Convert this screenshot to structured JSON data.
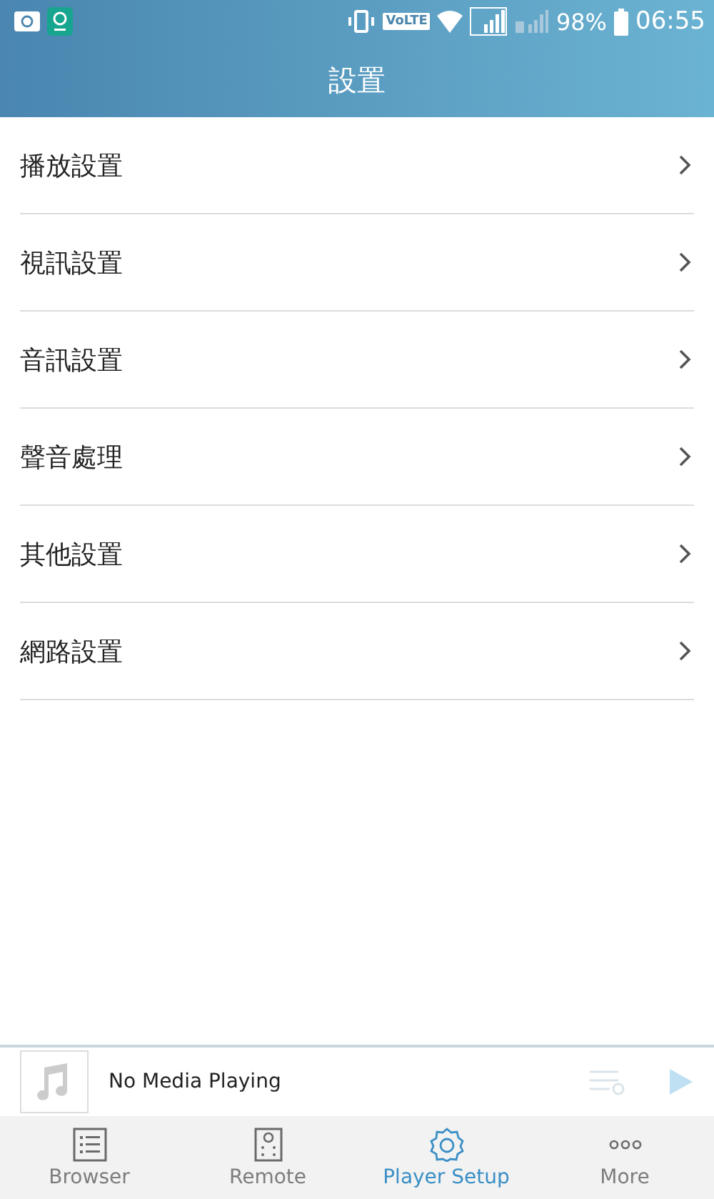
{
  "status_bar": {
    "volte": "VoLTE",
    "battery": "98%",
    "time": "06:55"
  },
  "header": {
    "title": "設置"
  },
  "settings": [
    {
      "label": "播放設置"
    },
    {
      "label": "視訊設置"
    },
    {
      "label": "音訊設置"
    },
    {
      "label": "聲音處理"
    },
    {
      "label": "其他設置"
    },
    {
      "label": "網路設置"
    }
  ],
  "now_playing": {
    "title": "No Media Playing"
  },
  "tabs": [
    {
      "label": "Browser",
      "kind": "list",
      "selected": false
    },
    {
      "label": "Remote",
      "kind": "remote",
      "selected": false
    },
    {
      "label": "Player Setup",
      "kind": "gear",
      "selected": true
    },
    {
      "label": "More",
      "kind": "more",
      "selected": false
    }
  ]
}
